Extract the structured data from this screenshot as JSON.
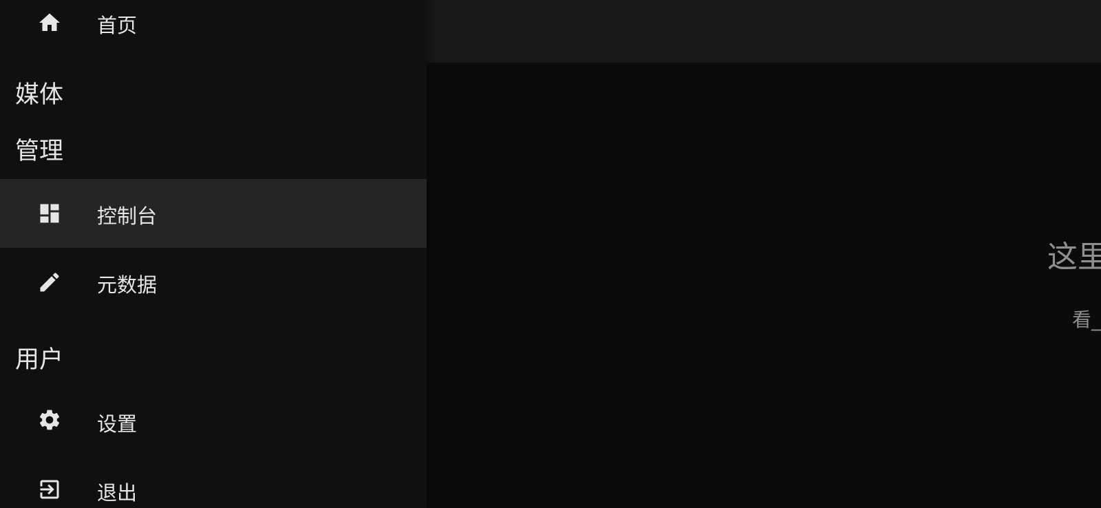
{
  "drawer": {
    "home": {
      "label": "首页",
      "icon": "home-icon"
    },
    "sections": {
      "media": "媒体",
      "admin": "管理",
      "user": "用户"
    },
    "admin_items": [
      {
        "label": "控制台",
        "icon": "dashboard-icon",
        "selected": true
      },
      {
        "label": "元数据",
        "icon": "pencil-icon",
        "selected": false
      }
    ],
    "user_items": [
      {
        "label": "设置",
        "icon": "gear-icon"
      },
      {
        "label": "退出",
        "icon": "logout-icon"
      }
    ]
  },
  "main": {
    "empty_title": "这里",
    "empty_subtitle": "看_"
  },
  "colors": {
    "drawer_bg": "#101010",
    "selected_bg": "#252527",
    "header_bg": "#181818",
    "main_bg": "#0b0b0b",
    "text": "#e6e6e6",
    "muted_text": "#8f8f8f"
  }
}
